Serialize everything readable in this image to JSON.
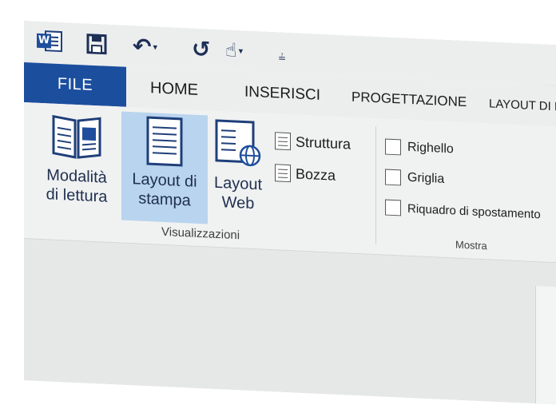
{
  "quick_access": {
    "app_icon": "word-logo-icon",
    "app_letter": "W",
    "save": "save-icon",
    "undo": "undo-icon",
    "undo_glyph": "↶",
    "redo_glyph": "↺",
    "touch_glyph": "☝",
    "dropdown_glyph": "▾",
    "customize_glyph": "≟"
  },
  "tabs": {
    "file": "FILE",
    "home": "HOME",
    "inserisci": "INSERISCI",
    "progettazione": "PROGETTAZIONE",
    "layout": "LAYOUT DI P"
  },
  "ribbon": {
    "views": {
      "read_mode_line1": "Modalità",
      "read_mode_line2": "di lettura",
      "print_layout_line1": "Layout di",
      "print_layout_line2": "stampa",
      "web_layout_line1": "Layout",
      "web_layout_line2": "Web",
      "struttura": "Struttura",
      "bozza": "Bozza",
      "group_label": "Visualizzazioni"
    },
    "show": {
      "righello": "Righello",
      "griglia": "Griglia",
      "riquadro": "Riquadro di spostamento",
      "group_label": "Mostra"
    }
  },
  "colors": {
    "file_tab": "#1c4e9e",
    "selected_button": "#b9d4ee",
    "icon_stroke": "#1f3f7a"
  }
}
